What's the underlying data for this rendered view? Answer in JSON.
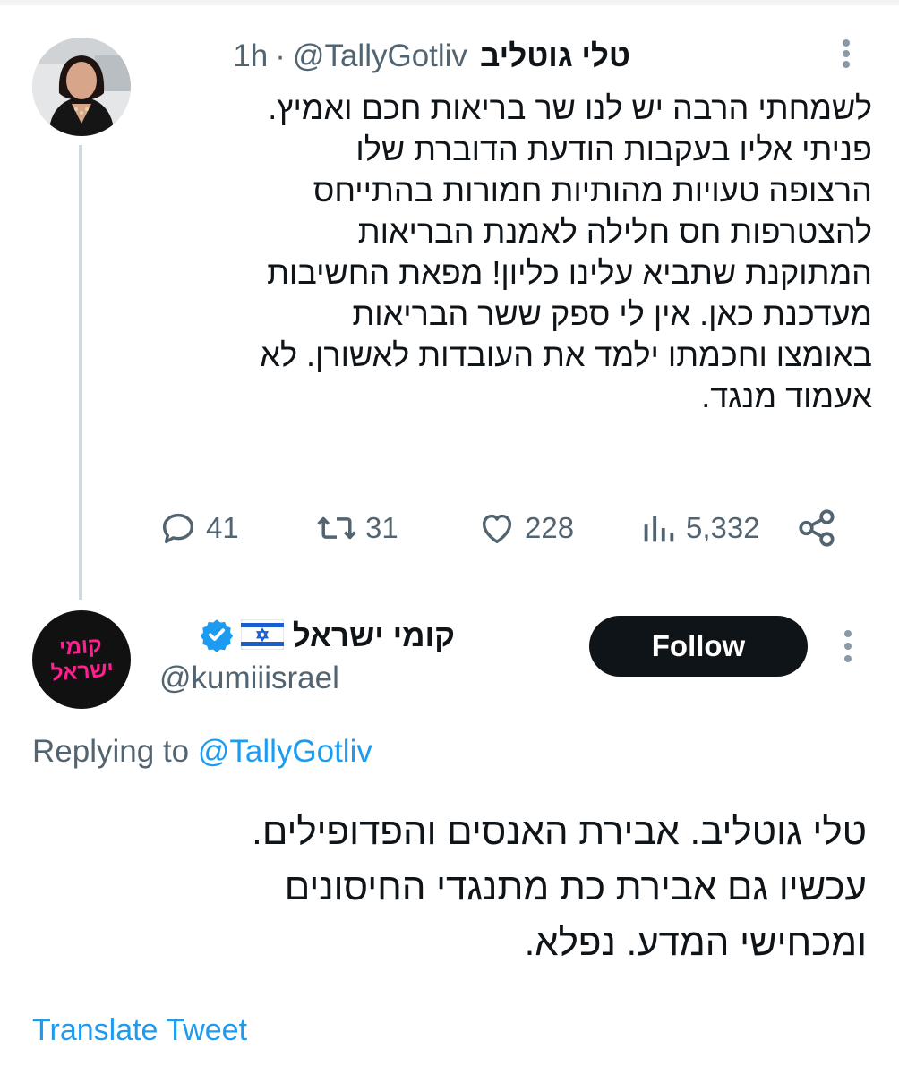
{
  "tweet": {
    "author_name": "טלי גוטליב",
    "handle": "@TallyGotliv",
    "separator": "·",
    "time": "1h",
    "text_lines": [
      "לשמחתי הרבה יש לנו שר בריאות חכם ואמיץ.",
      "פניתי אליו בעקבות הודעת הדוברת שלו",
      "הרצופה טעויות מהותיות חמורות בהתייחס",
      "להצטרפות חס חלילה לאמנת הבריאות",
      "המתוקנת שתביא עלינו כליון! מפאת החשיבות",
      "מעדכנת כאן. אין לי ספק ששר הבריאות",
      "באומצו וחכמתו ילמד את העובדות לאשורן. לא",
      "אעמוד מנגד."
    ],
    "stats": {
      "replies": "41",
      "retweets": "31",
      "likes": "228",
      "views": "5,332"
    },
    "icons": [
      "reply-icon",
      "retweet-icon",
      "like-icon",
      "views-icon",
      "share-icon",
      "more-icon"
    ]
  },
  "reply": {
    "author_name": "קומי ישראל",
    "handle": "@kumiiisrael",
    "avatar_text_line1": "קומי",
    "avatar_text_line2": "ישראל",
    "follow_label": "Follow",
    "replying_prefix": "Replying to ",
    "replying_to": "@TallyGotliv",
    "text_lines": [
      "טלי גוטליב. אבירת האנסים והפדופילים.",
      "עכשיו גם אבירת כת מתנגדי החיסונים",
      "ומכחישי המדע. נפלא."
    ],
    "translate_label": "Translate Tweet",
    "icons": [
      "verified-badge-icon",
      "israel-flag-icon",
      "more-icon"
    ]
  },
  "colors": {
    "text": "#0f1419",
    "secondary": "#536471",
    "link": "#1d9bf0",
    "follow_bg": "#0f1419",
    "logo_pink": "#ff1f8f",
    "thread_line": "#cfd9de"
  }
}
